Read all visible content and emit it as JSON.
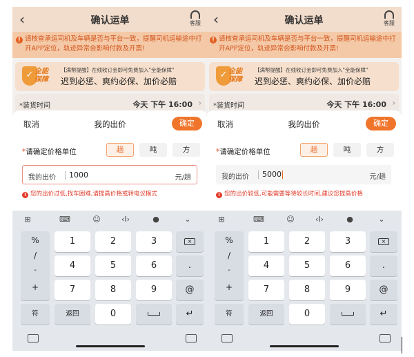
{
  "screens": [
    {
      "header": {
        "title": "确认运单",
        "service_label": "客服"
      },
      "notice": "请核查承运司机及车辆是否与平台一致，提醒司机运输途中打开APP定位，轨迹异常会影响付款及开票!",
      "guarantee": {
        "badge": "全能保障",
        "line1": "【满帮提醒】在线收订金即可免费加入\"全能保障\"",
        "line2": "迟到必惩、爽约必保、加价必赔"
      },
      "loading_time": {
        "label": "*装货时间",
        "value": "今天 下午 16:00"
      },
      "sheet": {
        "cancel": "取消",
        "title": "我的出价",
        "confirm": "确定",
        "unit_label_star": "*",
        "unit_label": "请确定价格单位",
        "units": [
          "趟",
          "吨",
          "方"
        ],
        "selected_unit": "趟",
        "price_label": "我的出价",
        "price_value": "1000",
        "price_unit": "元/趟",
        "warning": "您的出价过低,找车困难,请提高价格或转电议模式"
      }
    },
    {
      "header": {
        "title": "确认运单",
        "service_label": "客服"
      },
      "notice": "请核查承运司机及车辆是否与平台一致，提醒司机运输途中打开APP定位，轨迹异常会影响付款及开票!",
      "guarantee": {
        "badge": "全能保障",
        "line1": "【满帮提醒】在线收订金即可免费加入\"全能保障\"",
        "line2": "迟到必惩、爽约必保、加价必赔"
      },
      "loading_time": {
        "label": "*装货时间",
        "value": "今天 下午 16:00"
      },
      "sheet": {
        "cancel": "取消",
        "title": "我的出价",
        "confirm": "确定",
        "unit_label_star": "*",
        "unit_label": "请确定价格单位",
        "units": [
          "趟",
          "吨",
          "方"
        ],
        "selected_unit": "趟",
        "price_label": "我的出价",
        "price_value": "5000",
        "price_unit": "元/趟",
        "warning": "您的出价较低,可能需要等待较长时间,建议您提高价格"
      }
    }
  ],
  "keyboard": {
    "symbols": [
      "%",
      "/",
      "-",
      "+"
    ],
    "rows": [
      [
        "1",
        "2",
        "3"
      ],
      [
        "4",
        "5",
        "6"
      ],
      [
        "7",
        "8",
        "9"
      ]
    ],
    "right_keys": [
      ".",
      "@"
    ],
    "bottom": {
      "sym": "符",
      "back": "返回",
      "zero": "0"
    }
  },
  "colors": {
    "accent": "#f0752b",
    "warning": "#e23b2a",
    "notice_bg": "#f4c9a7"
  }
}
